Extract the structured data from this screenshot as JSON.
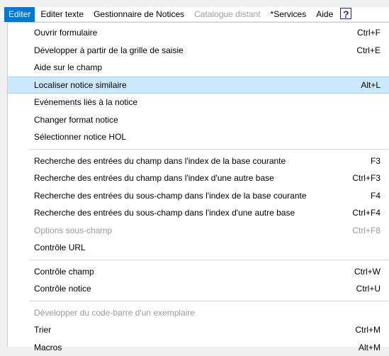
{
  "menubar": {
    "items": [
      {
        "label": "Editer",
        "active": true
      },
      {
        "label": "Editer texte"
      },
      {
        "label": "Gestionnaire de Notices"
      },
      {
        "label": "Catalogue distant",
        "disabled": true
      },
      {
        "label": "*Services"
      },
      {
        "label": "Aide"
      }
    ],
    "help_icon_glyph": "?"
  },
  "menu": {
    "groups": [
      [
        {
          "label": "Ouvrir formulaire",
          "shortcut": "Ctrl+F"
        },
        {
          "label": "Développer à partir de la grille de saisie",
          "shortcut": "Ctrl+E"
        },
        {
          "label": "Aide sur le champ",
          "shortcut": ""
        },
        {
          "label": "Localiser notice similaire",
          "shortcut": "Alt+L",
          "highlighted": true
        },
        {
          "label": "Evénements liés à la notice",
          "shortcut": ""
        },
        {
          "label": "Changer format notice",
          "shortcut": ""
        },
        {
          "label": "Sélectionner notice HOL",
          "shortcut": ""
        }
      ],
      [
        {
          "label": "Recherche des entrées du champ dans l'index de la base courante",
          "shortcut": "F3"
        },
        {
          "label": "Recherche des entrées du champ dans l'index d'une autre base",
          "shortcut": "Ctrl+F3"
        },
        {
          "label": "Recherche des entrées du sous-champ dans l'index de la base courante",
          "shortcut": "F4"
        },
        {
          "label": "Recherche des entrées du sous-champ dans l'index d'une autre base",
          "shortcut": "Ctrl+F4"
        },
        {
          "label": "Options sous-champ",
          "shortcut": "Ctrl+F8",
          "disabled": true
        },
        {
          "label": "Contrôle URL",
          "shortcut": ""
        }
      ],
      [
        {
          "label": "Contrôle champ",
          "shortcut": "Ctrl+W"
        },
        {
          "label": "Contrôle notice",
          "shortcut": "Ctrl+U"
        }
      ],
      [
        {
          "label": "Développer du code-barre d'un exemplaire",
          "shortcut": "",
          "disabled": true
        },
        {
          "label": "Trier",
          "shortcut": "Ctrl+M"
        },
        {
          "label": "Macros",
          "shortcut": "Alt+M"
        }
      ]
    ]
  },
  "colors": {
    "active_menu": "#0078d7",
    "highlight_bg": "#cce8ff",
    "highlight_border": "#99d1ff",
    "disabled_text": "#9a9a9a",
    "help_icon": "#1f1fb6"
  }
}
